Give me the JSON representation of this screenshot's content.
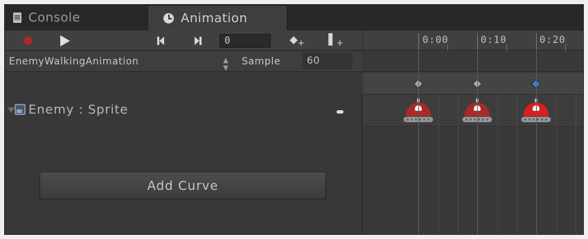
{
  "window": {
    "tabs": [
      {
        "label": "Console",
        "icon": "console-icon",
        "active": false
      },
      {
        "label": "Animation",
        "icon": "clock-icon",
        "active": true
      }
    ]
  },
  "toolbar": {
    "record_icon": "record-icon",
    "play_icon": "play-icon",
    "prev_key_icon": "previous-keyframe-icon",
    "next_key_icon": "next-keyframe-icon",
    "frame_value": "0",
    "add_keyframe_icon": "add-keyframe-icon",
    "add_event_icon": "add-event-icon",
    "record_color": "#b02828"
  },
  "ruler": {
    "labels": [
      "0:00",
      "0:10",
      "0:20"
    ]
  },
  "clip": {
    "name": "EnemyWalkingAnimation",
    "sample_label": "Sample",
    "sample_value": "60"
  },
  "property": {
    "label": "Enemy : Sprite"
  },
  "buttons": {
    "add_curve": "Add Curve"
  },
  "keyframes": [
    {
      "frame_label": "0:00",
      "selected": false,
      "sprite_color": "#a82a2a"
    },
    {
      "frame_label": "0:10",
      "selected": false,
      "sprite_color": "#a82a2a"
    },
    {
      "frame_label": "0:20",
      "selected": true,
      "sprite_color": "#d61f1f"
    }
  ],
  "colors": {
    "selected_key": "#3f7fd8",
    "key": "#a8a8a8",
    "background": "#383838"
  }
}
